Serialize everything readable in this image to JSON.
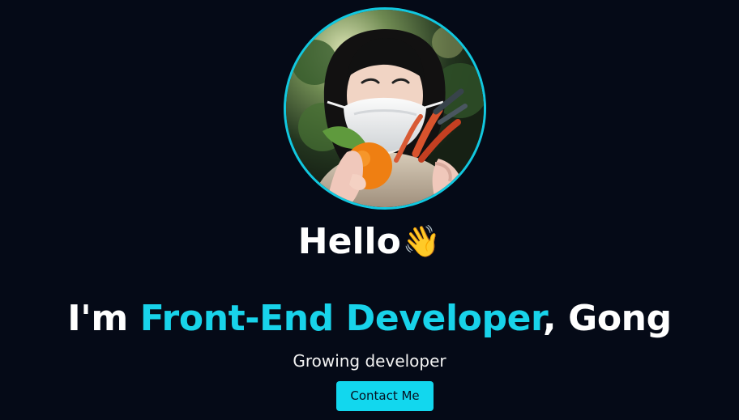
{
  "hero": {
    "greeting": "Hello",
    "wave_emoji": "👋",
    "headline_prefix": "I'm ",
    "headline_role": "Front-End Developer",
    "headline_suffix": ", Gong",
    "tagline": "Growing developer",
    "contact_label": "Contact Me"
  },
  "profile_image": {
    "icon": "profile-photo"
  },
  "colors": {
    "background": "#050a17",
    "accent": "#18d3ea",
    "button": "#12d7ee",
    "text": "#ffffff"
  }
}
